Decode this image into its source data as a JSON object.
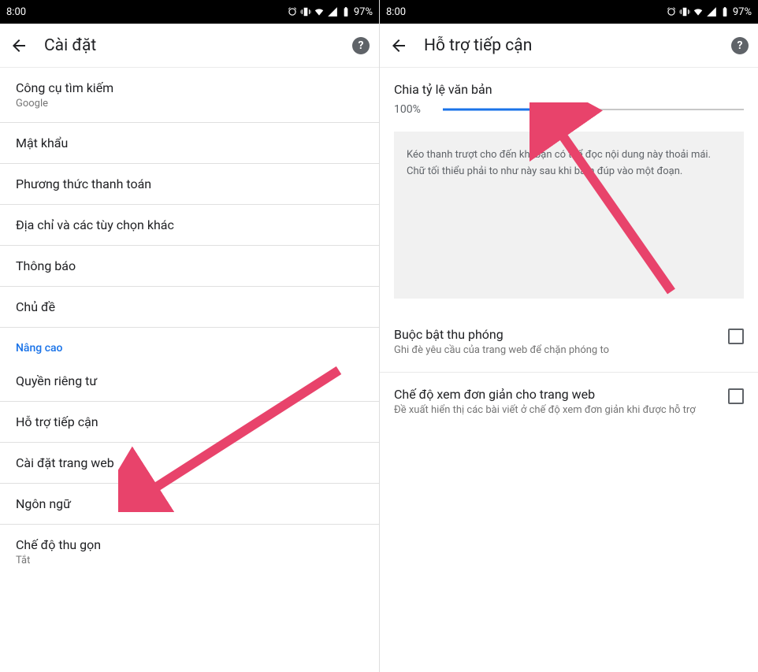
{
  "status": {
    "time": "8:00",
    "battery": "97%"
  },
  "left": {
    "title": "Cài đặt",
    "rows": [
      {
        "title": "Công cụ tìm kiếm",
        "sub": "Google"
      },
      {
        "title": "Mật khẩu"
      },
      {
        "title": "Phương thức thanh toán"
      },
      {
        "title": "Địa chỉ và các tùy chọn khác"
      },
      {
        "title": "Thông báo"
      },
      {
        "title": "Chủ đề"
      }
    ],
    "section": "Nâng cao",
    "advanced": [
      {
        "title": "Quyền riêng tư"
      },
      {
        "title": "Hỗ trợ tiếp cận"
      },
      {
        "title": "Cài đặt trang web"
      },
      {
        "title": "Ngôn ngữ"
      },
      {
        "title": "Chế độ thu gọn",
        "sub": "Tắt"
      }
    ]
  },
  "right": {
    "title": "Hỗ trợ tiếp cận",
    "textScale": {
      "label": "Chia tỷ lệ văn bản",
      "value": "100%"
    },
    "hint": "Kéo thanh trượt cho đến khi bạn có thể đọc nội dung này thoải mái. Chữ tối thiểu phải to như này sau khi bấm đúp vào một đoạn.",
    "checks": [
      {
        "title": "Buộc bật thu phóng",
        "sub": "Ghi đè yêu cầu của trang web để chặn phóng to"
      },
      {
        "title": "Chế độ xem đơn giản cho trang web",
        "sub": "Đề xuất hiển thị các bài viết ở chế độ xem đơn giản khi được hỗ trợ"
      }
    ]
  }
}
